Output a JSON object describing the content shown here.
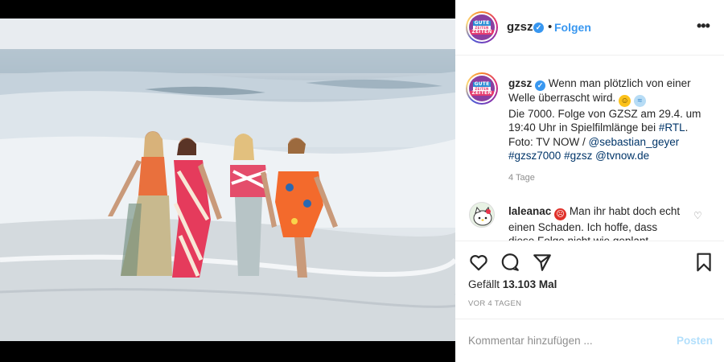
{
  "post": {
    "photo_alt": "Vier Frauen in bunten Sommerkleidern laufen lachend durch die Brandung am Strand"
  },
  "header": {
    "avatar_logo": [
      "GUTE",
      "ZEITEN",
      "ZEITEN"
    ],
    "username": "gzsz",
    "verified_mark": "✓",
    "separator": "•",
    "follow_label": "Folgen",
    "more_label": "•••"
  },
  "caption": {
    "username": "gzsz",
    "line1": "Wenn man plötzlich von einer Welle überrascht wird. ",
    "emoji1": "grinning-face",
    "emoji2": "water-wave",
    "line2": "Die 7000. Folge von GZSZ am 29.4. um 19:40 Uhr in Spielfilmlänge bei ",
    "tag_rtl": "#RTL",
    "line3": ". Foto: TV NOW / ",
    "mention1": "@sebastian_geyer",
    "tag1": "#gzsz7000",
    "tag2": "#gzsz",
    "mention2": "@tvnow.de",
    "time": "4 Tage"
  },
  "comment": {
    "username": "laleanac",
    "emoji": "angry-face",
    "text": "Man ihr habt doch echt einen Schaden. Ich hoffe, dass diese Folge nicht wie geplant"
  },
  "actions": {
    "likes_prefix": "Gefällt ",
    "likes_count": "13.103",
    "likes_suffix": " Mal",
    "date": "VOR 4 TAGEN"
  },
  "add_comment": {
    "placeholder": "Kommentar hinzufügen ...",
    "post_label": "Posten"
  },
  "colors": {
    "accent": "#3897f0",
    "link": "#003569",
    "post_disabled": "#b2dffc",
    "muted": "#8e8e8e"
  }
}
